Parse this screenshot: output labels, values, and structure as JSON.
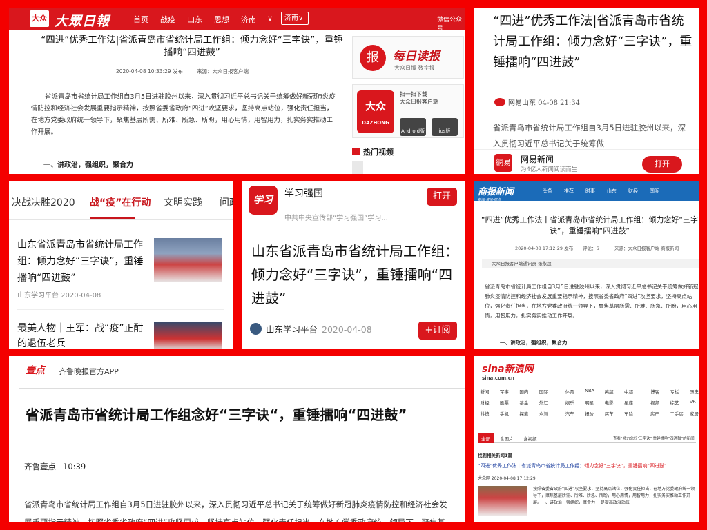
{
  "dazhong": {
    "logo": "大众",
    "name": "大眾日報",
    "nav": [
      "首页",
      "战疫",
      "山东",
      "思想",
      "济南"
    ],
    "chevron": "∨",
    "city_select": "济南∨",
    "wechat": "微信公众号",
    "title": "“四进”优秀工作法|省派青岛市省统计局工作组：倾力念好“三字诀”，重锤播响“四进鼓”",
    "published": "2020-04-08 10:33:29 发布",
    "source": "来源：大众日报客户端",
    "body": "省派青岛市省统计局工作组自3月5日进驻胶州以来，深入贯彻习近平总书记关于统筹做好新冠肺炎疫情防控和经济社会发展重要指示精神，按照省委省政府“四进”攻坚要求，坚持高点站位，强化责任担当，在地方党委政府统一领导下，聚焦基层所需、所难、所急、所盼，用心用情，用智用力，扎实务实推动工作开展。",
    "heading": "一、讲政治，强组织，聚合力",
    "ad1_icon": "报",
    "ad1_title": "每日读报",
    "ad1_sub": "大众日报 数字报",
    "ad2_logo": "大众",
    "ad2_logo_sub": "DAZHONG",
    "ad2_scan": "扫一扫下载",
    "ad2_client": "大众日报客户端",
    "ad2_android": "Android版",
    "ad2_ios": "ios版",
    "hot_video": "热门视频"
  },
  "netease": {
    "title": "“四进”优秀工作法|省派青岛市省统计局工作组：倾力念好“三字诀”，重锤擂响“四进鼓”",
    "source": "网易山东 04-08 21:34",
    "body": "省派青岛市省统计局工作组自3月5日进驻胶州以来，深入贯彻习近平总书记关于统筹做",
    "app_icon": "網易",
    "app_name": "网易新闻",
    "app_sub": "为4亿人新闻阅读而生",
    "open": "打开"
  },
  "xuexi_web": {
    "tabs": [
      "决战决胜2020",
      "战“疫”在行动",
      "文明实践",
      "问政"
    ],
    "headline1": "山东省派青岛市省统计局工作组：倾力念好“三字诀”，重锤播响“四进鼓”",
    "meta1": "山东学习平台  2020-04-08",
    "headline2": "最美人物｜王军：战“疫”正酣的退伍老兵"
  },
  "xuexi_app": {
    "logo": "学习",
    "name": "学习强国",
    "open": "打开",
    "sub": "中共中央宣传部“学习强国”学习...",
    "title": "山东省派青岛市省统计局工作组：倾力念好“三字诀”，重锤擂响“四进鼓”",
    "source": "山东学习平台",
    "date": "2020-04-08",
    "subscribe": "+订阅"
  },
  "shangbao": {
    "logo": "商报新闻",
    "logo_sub": "新闻·资讯·观点",
    "nav": [
      "头条",
      "推荐",
      "时事",
      "山东",
      "财经",
      "国际"
    ],
    "title": "“四进”优秀工作法丨省派青岛市省统计局工作组：倾力念好“三字诀”，重锤擂响“四进鼓”",
    "date": "2020-04-08 17:12:29 发布",
    "comments": "评论：6",
    "source": "来源：大众日报客户端·商报新闻",
    "reporter": "大众日报客户端通讯员 张永超",
    "body": "省派青岛市省统计局工作组自3月5日进驻胶州以来，深入贯彻习近平总书记关于统筹做好新冠肺炎疫情防控和经济社会发展重要指示精神，按照省委省政府“四进”攻坚要求，坚持高点站位，强化责任担当，在地方党委政府统一领导下，聚焦基层所需、所难、所急、所盼，用心用情，用智用力，扎实务实推动工作开展。",
    "heading": "一、讲政治，强组织，聚合力"
  },
  "qilu": {
    "logo": "壹点",
    "app": "齐鲁晚报官方APP",
    "title": "省派青岛市省统计局工作组念好“三字诀“，重锤擂响“四进鼓”",
    "source": "齐鲁壹点",
    "time": "10:39",
    "body": "省派青岛市省统计局工作组自3月5日进驻胶州以来，深入贯彻习近平总书记关于统筹做好新冠肺炎疫情防控和经济社会发展重要指示精神，按照省委省政府“四进”攻坚要求，坚持高点站位，强化责任担当，在地方党委政府统一领导下，聚焦基层"
  },
  "sina": {
    "logo": "sina新浪网",
    "logo_sub": "sina.com.cn",
    "grid": [
      [
        "新闻",
        "军事",
        "国内",
        "国际",
        "体育",
        "NBA",
        "英超",
        "中超",
        "博客",
        "专栏",
        "历史",
        "天气"
      ],
      [
        "财经",
        "股票",
        "基金",
        "外汇",
        "娱乐",
        "明星",
        "电影",
        "星座",
        "视频",
        "综艺",
        "VR",
        "直播"
      ],
      [
        "科技",
        "手机",
        "探索",
        "众测",
        "汽车",
        "报价",
        "买车",
        "车险",
        "房产",
        "二手房",
        "家居",
        "收藏"
      ]
    ],
    "tabs": [
      "全部",
      "含图片",
      "含视频"
    ],
    "query": "查看\"倾力念好'三字诀'\"重锤擂响\"四进鼓\"的新闻",
    "found": "找到相关新闻1篇",
    "result_title_a": "“四进”优秀工作法丨省派青岛市省统计局工作组：",
    "result_title_b": "倾力念好“三字诀”，重锤擂响“四进鼓”",
    "result_date": "大众网 2020-04-08 17:12:29",
    "result_text": "按照省委省政府“四进”攻坚要求，坚持高点站位，强化责任担当，在地方党委政府统一领导下，聚焦基层所需、所难、所急、所盼，用心用情，用智用力，扎实务实推动工作开展。一、讲政治，强组织，聚合力 一是提高政治站位"
  }
}
